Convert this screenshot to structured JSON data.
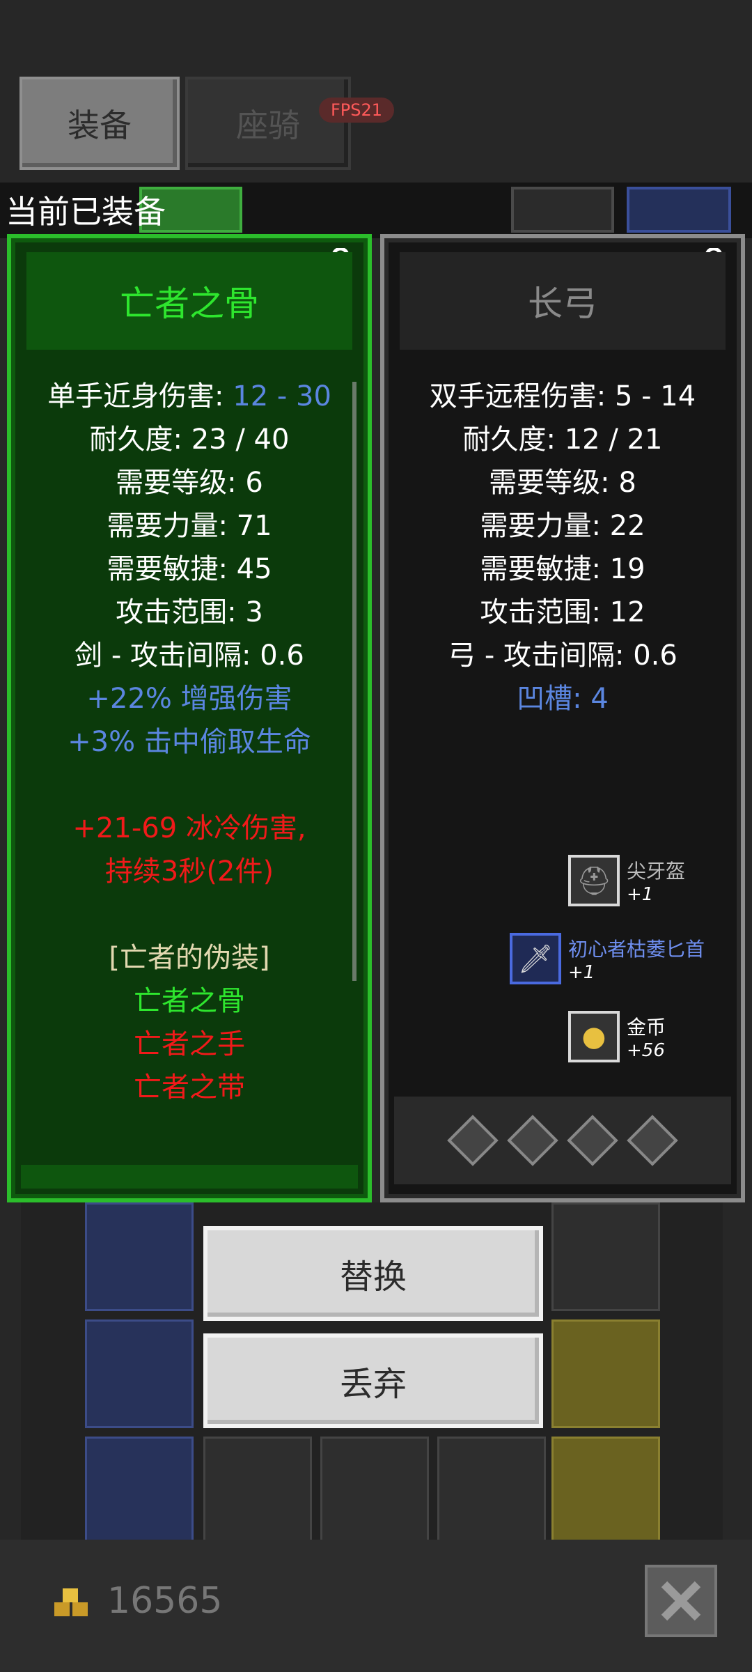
{
  "tabs": {
    "equip": "装备",
    "mount": "座骑"
  },
  "fps": "FPS21",
  "equipped_label": "当前已装备",
  "left_item": {
    "name": "亡者之骨",
    "stats": [
      {
        "label": "单手近身伤害: ",
        "value": "12 - 30"
      },
      {
        "text": "耐久度: 23 / 40"
      },
      {
        "text": "需要等级: 6"
      },
      {
        "text": "需要力量: 71"
      },
      {
        "text": "需要敏捷: 45"
      },
      {
        "text": "攻击范围: 3"
      },
      {
        "text": "剑 - 攻击间隔: 0.6"
      }
    ],
    "bonuses": [
      "+22% 增强伤害",
      "+3% 击中偷取生命"
    ],
    "set_bonus": [
      "+21-69 冰冷伤害,",
      "持续3秒(2件)"
    ],
    "set_name": "[亡者的伪装]",
    "set_items": [
      {
        "name": "亡者之骨",
        "owned": true
      },
      {
        "name": "亡者之手",
        "owned": false
      },
      {
        "name": "亡者之带",
        "owned": false
      }
    ]
  },
  "right_item": {
    "name": "长弓",
    "stats": [
      "双手远程伤害: 5 - 14",
      "耐久度: 12 / 21",
      "需要等级: 8",
      "需要力量: 22",
      "需要敏捷: 19",
      "攻击范围: 12",
      "弓 - 攻击间隔: 0.6"
    ],
    "sockets_label": "凹槽: 4",
    "sockets": 4
  },
  "loot": [
    {
      "name": "尖牙盔",
      "count": "+1",
      "color": "#bdbdbd",
      "icon": "helmet-icon"
    },
    {
      "name": "初心者枯萎匕首",
      "count": "+1",
      "color": "#6f8ff0",
      "icon": "dagger-icon"
    },
    {
      "name": "金币",
      "count": "+56",
      "color": "#ffffff",
      "icon": "gold-coins-icon"
    }
  ],
  "buttons": {
    "replace": "替换",
    "discard": "丢弃"
  },
  "gold": "16565",
  "colors": {
    "set_green": "#2ee62e",
    "magic_blue": "#5b86e0",
    "set_red": "#f01a1a",
    "rarity_border_left": "#2bbd2b"
  }
}
